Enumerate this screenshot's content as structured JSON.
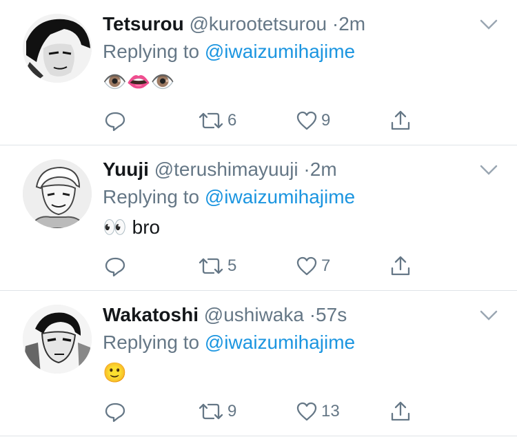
{
  "tweets": [
    {
      "name": "Tetsurou",
      "handle": "@kurootetsurou",
      "time": "2m",
      "replying_prefix": "Replying to",
      "replying_to": "@iwaizumihajime",
      "text": "👁️👄👁️",
      "retweets": "6",
      "likes": "9",
      "avatar_icon": "avatar-manga-dark-hair"
    },
    {
      "name": "Yuuji",
      "handle": "@terushimayuuji",
      "time": "2m",
      "replying_prefix": "Replying to",
      "replying_to": "@iwaizumihajime",
      "text": "👀 bro",
      "retweets": "5",
      "likes": "7",
      "avatar_icon": "avatar-manga-light-hair"
    },
    {
      "name": "Wakatoshi",
      "handle": "@ushiwaka",
      "time": "57s",
      "replying_prefix": "Replying to",
      "replying_to": "@iwaizumihajime",
      "text": "🙂",
      "retweets": "9",
      "likes": "13",
      "avatar_icon": "avatar-manga-dark-hair"
    }
  ],
  "separator": "·",
  "colors": {
    "name": "#14171a",
    "secondary": "#657786",
    "link": "#1b95e0",
    "divider": "#dfe3e7"
  },
  "icons": [
    "reply-icon",
    "retweet-icon",
    "like-icon",
    "share-icon",
    "chevron-down-icon"
  ]
}
